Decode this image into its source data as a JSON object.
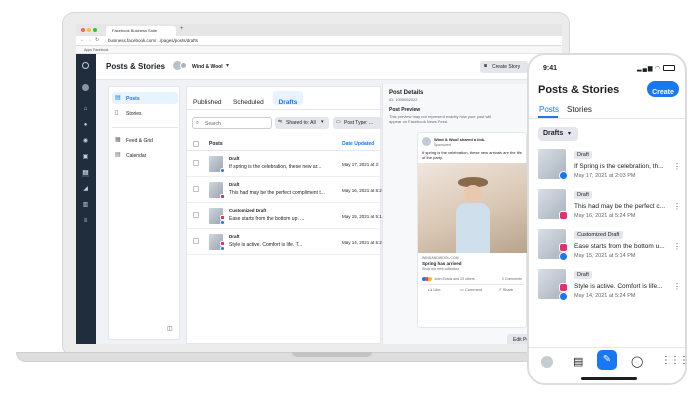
{
  "browser": {
    "tab_title": "Facebook Business Suite",
    "url": "business.facebook.com/.../pages/posts/drafts",
    "bookmarks": "Apps   Facebook"
  },
  "header": {
    "title": "Posts & Stories",
    "account": "Wind & Wool",
    "create_story": "Create Story"
  },
  "left_nav": [
    {
      "label": "Posts",
      "icon": "posts-icon"
    },
    {
      "label": "Stories",
      "icon": "stories-icon"
    },
    {
      "label": "Feed & Grid",
      "icon": "grid-icon"
    },
    {
      "label": "Calendar",
      "icon": "calendar-icon"
    }
  ],
  "tabs": [
    "Published",
    "Scheduled",
    "Drafts"
  ],
  "search_placeholder": "Search",
  "filters": {
    "shared": "Shared to: All",
    "post_type": "Post Type: ..."
  },
  "table": {
    "col_posts": "Posts",
    "col_date": "Date Updated",
    "rows": [
      {
        "badge": "Draft",
        "text": "If spring is the celebration, these new ar...",
        "date": "May 17, 2021 at 2:"
      },
      {
        "badge": "Draft",
        "text": "This had may be the perfect compliment t...",
        "date": "May 16, 2021 at 5:2"
      },
      {
        "badge": "Customized Draft",
        "text": "Ease starts from the bottom up. ...",
        "date": "May 15, 2021 at 5:1"
      },
      {
        "badge": "Draft",
        "text": "Style is active. Comfort is life. T...",
        "date": "May 14, 2021 at 5:2"
      }
    ]
  },
  "details": {
    "title": "Post Details",
    "id": "ID: 1000052022",
    "preview_title": "Post Preview",
    "preview_note": "This preview may not represent exactly how your post will appear on Facebook News Feed.",
    "page_name": "Wind & Wool shared a link.",
    "sponsored": "Sponsored",
    "caption": "If spring is the celebration, these new arrivals are the life of the party.",
    "link_domain": "WINDANDWOOL.COM",
    "link_title": "Spring has arrived",
    "link_desc": "Shop our new collection",
    "reactions": "John Evans and 23 others",
    "comments_count": "2 Comments",
    "like": "Like",
    "comment": "Comment",
    "share": "Share",
    "edit": "Edit Post"
  },
  "phone": {
    "time": "9:41",
    "title": "Posts & Stories",
    "create": "Create",
    "tabs": [
      "Posts",
      "Stories"
    ],
    "filter": "Drafts",
    "items": [
      {
        "badge": "Draft",
        "text": "If Spring is the celebration, th...",
        "date": "May 17, 2021 at 2:03 PM"
      },
      {
        "badge": "Draft",
        "text": "This had may be the perfect c...",
        "date": "May 16, 2021 at 5:24 PM"
      },
      {
        "badge": "Customized Draft",
        "text": "Ease starts from the bottom u...",
        "date": "May 15, 2021 at 5:14 PM"
      },
      {
        "badge": "Draft",
        "text": "Style is active. Comfort is life...",
        "date": "May 14, 2021 at 5:24 PM"
      }
    ]
  },
  "colors": {
    "accent": "#1877f2",
    "nav_dark": "#1f2d3d",
    "instagram": "#e1306c"
  }
}
